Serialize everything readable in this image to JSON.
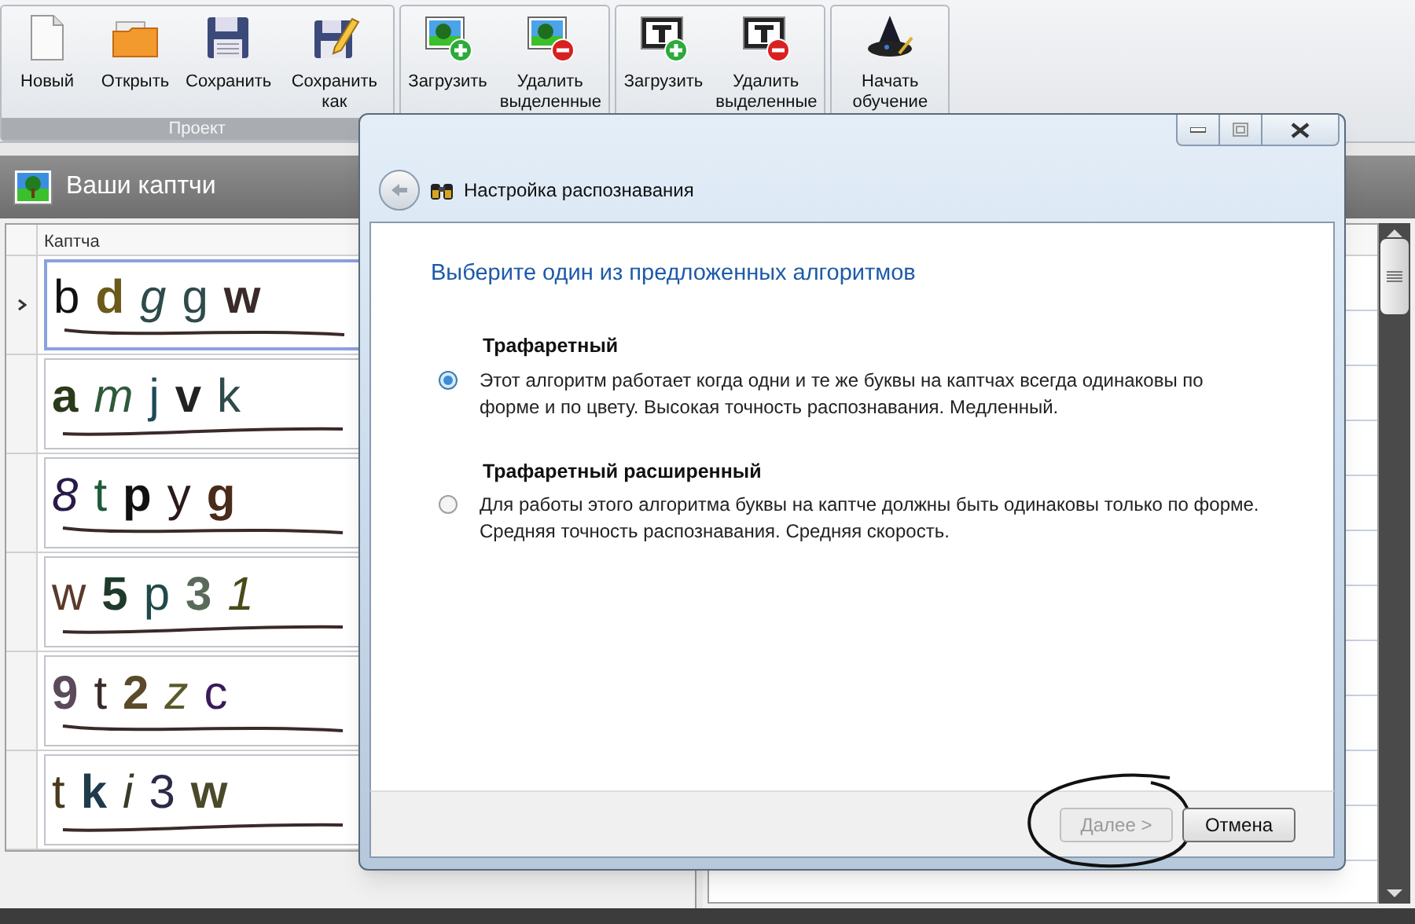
{
  "toolbar": {
    "groups": [
      {
        "label": "Проект",
        "buttons": [
          {
            "label": "Новый"
          },
          {
            "label": "Открыть"
          },
          {
            "label": "Сохранить"
          },
          {
            "label": "Сохранить как"
          }
        ]
      },
      {
        "buttons": [
          {
            "label": "Загрузить"
          },
          {
            "label": "Удалить выделенные"
          }
        ]
      },
      {
        "buttons": [
          {
            "label": "Загрузить"
          },
          {
            "label": "Удалить выделенные"
          }
        ]
      },
      {
        "buttons": [
          {
            "label": "Начать обучение"
          }
        ]
      }
    ]
  },
  "captcha_panel": {
    "title": "Ваши каптчи",
    "column": "Каптча",
    "rows": [
      {
        "text": "bdggw",
        "selected": true
      },
      {
        "text": "amjvk",
        "selected": false
      },
      {
        "text": "8tpyg",
        "selected": false
      },
      {
        "text": "w5p31",
        "selected": false
      },
      {
        "text": "9t2zc",
        "selected": false
      },
      {
        "text": "tki3w",
        "selected": false
      }
    ]
  },
  "dialog": {
    "nav_title": "Настройка распознавания",
    "heading": "Выберите один из предложенных алгоритмов",
    "options": [
      {
        "title": "Трафаретный",
        "description": "Этот алгоритм работает когда одни и те же буквы на каптчах всегда одинаковы по форме и по цвету. Высокая точность распознавания. Медленный.",
        "selected": true
      },
      {
        "title": "Трафаретный расширенный",
        "description": "Для работы этого алгоритма буквы на каптче должны быть одинаковы только по форме. Средняя точность распознавания. Средняя скорость.",
        "selected": false
      }
    ],
    "buttons": [
      {
        "label": "Далее >",
        "disabled": true,
        "circled": true
      },
      {
        "label": "Отмена",
        "disabled": false
      }
    ]
  }
}
